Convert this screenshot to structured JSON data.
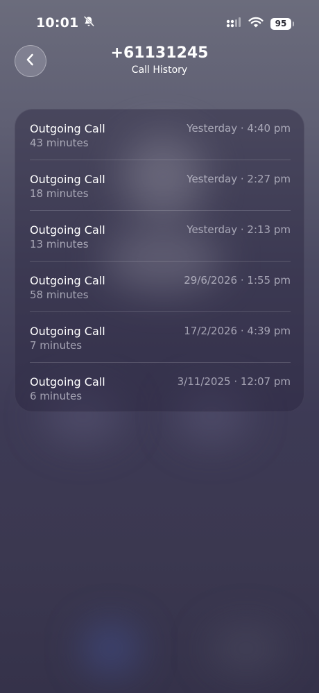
{
  "status_bar": {
    "time": "10:01",
    "battery": "95"
  },
  "header": {
    "title": "+61131245",
    "subtitle": "Call History"
  },
  "calls": [
    {
      "title": "Outgoing Call",
      "duration": "43 minutes",
      "date": "Yesterday · 4:40 pm"
    },
    {
      "title": "Outgoing Call",
      "duration": "18 minutes",
      "date": "Yesterday · 2:27 pm"
    },
    {
      "title": "Outgoing Call",
      "duration": "13 minutes",
      "date": "Yesterday · 2:13 pm"
    },
    {
      "title": "Outgoing Call",
      "duration": "58 minutes",
      "date": "29/6/2026 · 1:55 pm"
    },
    {
      "title": "Outgoing Call",
      "duration": "7 minutes",
      "date": "17/2/2026 · 4:39 pm"
    },
    {
      "title": "Outgoing Call",
      "duration": "6 minutes",
      "date": "3/11/2025 · 12:07 pm"
    }
  ],
  "icons": {
    "mute": "bell-slash-icon",
    "signal": "cellular-signal-icon",
    "wifi": "wifi-icon",
    "back": "chevron-left-icon"
  }
}
